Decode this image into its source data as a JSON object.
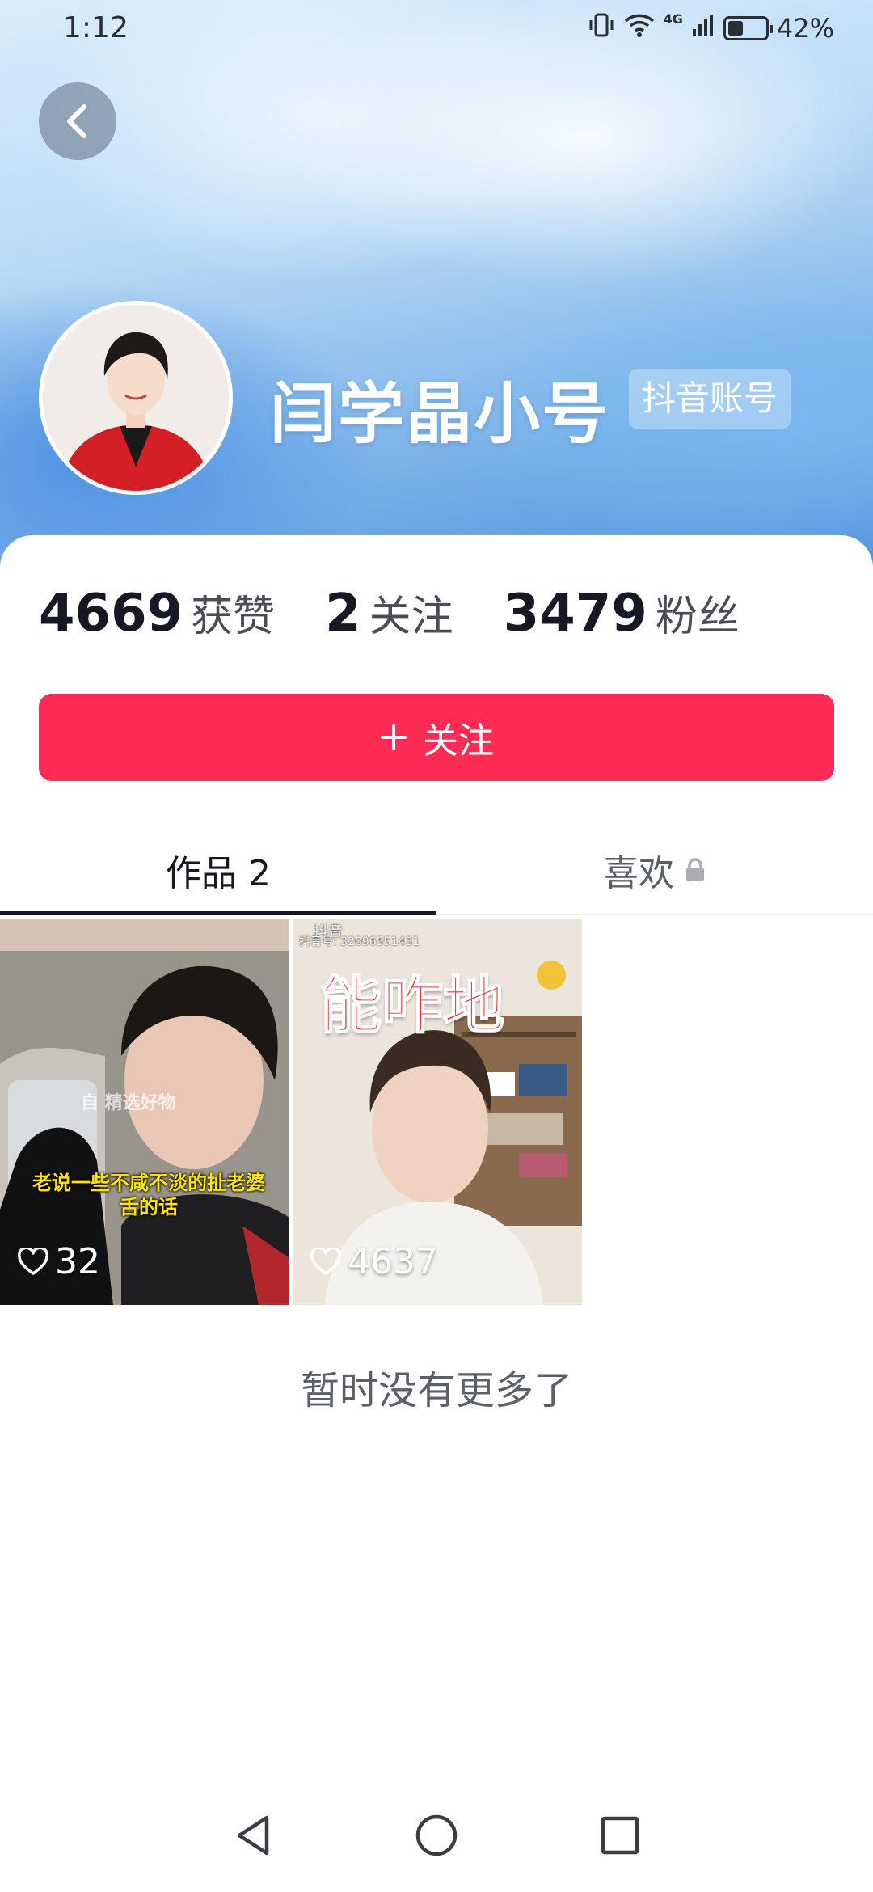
{
  "status_bar": {
    "time": "1:12",
    "network": "4G",
    "battery_percent": "42%",
    "battery_level": 0.42
  },
  "profile": {
    "name": "闫学晶小号",
    "account_badge": "抖音账号"
  },
  "stats": [
    {
      "value": "4669",
      "label": "获赞"
    },
    {
      "value": "2",
      "label": "关注"
    },
    {
      "value": "3479",
      "label": "粉丝"
    }
  ],
  "follow_button": {
    "label": "关注"
  },
  "tabs": [
    {
      "label": "作品 2",
      "active": true
    },
    {
      "label": "喜欢",
      "locked": true
    }
  ],
  "videos": [
    {
      "likes": "32",
      "caption": "老说一些不咸不淡的扯老婆舌的话",
      "caption_line1": "老说一些不咸不淡的扯老婆",
      "caption_line2": "舌的话",
      "watermark": "自 精选好物"
    },
    {
      "likes": "4637",
      "title": "能咋地",
      "app_label": "抖音",
      "douyin_id": "抖音号: 32096551431"
    }
  ],
  "footer": {
    "no_more_text": "暂时没有更多了"
  },
  "colors": {
    "accent": "#fe2c55",
    "text_primary": "#161823"
  }
}
